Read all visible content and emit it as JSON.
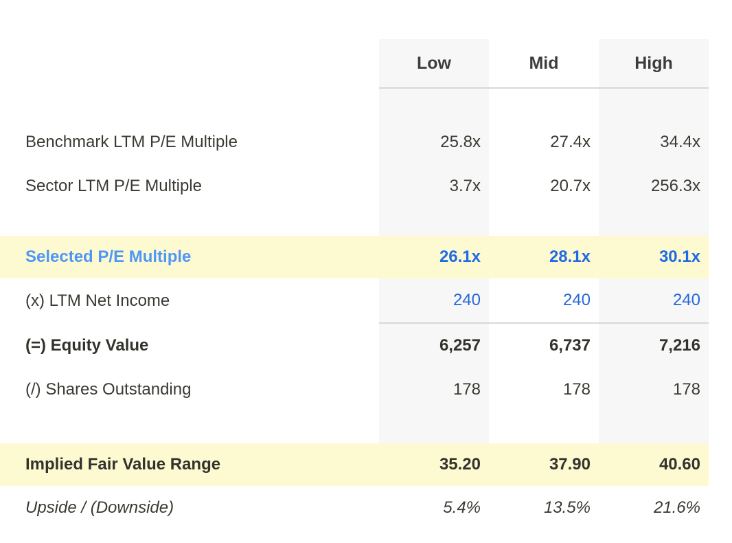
{
  "table": {
    "columns": [
      "Low",
      "Mid",
      "High"
    ],
    "label_column_header": "",
    "colors": {
      "highlight_bg": "#fdfad2",
      "column_shade": "#f7f7f7",
      "accent_blue_label": "#4f97f7",
      "accent_blue_value": "#1f6ae4",
      "value_blue": "#2568d8",
      "text": "#3a3a33",
      "rule": "#d8d8d8"
    },
    "rows": [
      {
        "label": "Benchmark LTM P/E Multiple",
        "values": [
          "25.8x",
          "27.4x",
          "34.4x"
        ]
      },
      {
        "label": "Sector LTM P/E Multiple",
        "values": [
          "3.7x",
          "20.7x",
          "256.3x"
        ]
      },
      {
        "label": "Selected P/E Multiple",
        "values": [
          "26.1x",
          "28.1x",
          "30.1x"
        ]
      },
      {
        "label": "(x) LTM Net Income",
        "values": [
          "240",
          "240",
          "240"
        ]
      },
      {
        "label": "(=) Equity Value",
        "values": [
          "6,257",
          "6,737",
          "7,216"
        ]
      },
      {
        "label": "(/) Shares Outstanding",
        "values": [
          "178",
          "178",
          "178"
        ]
      },
      {
        "label": "Implied Fair Value Range",
        "values": [
          "35.20",
          "37.90",
          "40.60"
        ]
      },
      {
        "label": "Upside / (Downside)",
        "values": [
          "5.4%",
          "13.5%",
          "21.6%"
        ]
      }
    ]
  }
}
